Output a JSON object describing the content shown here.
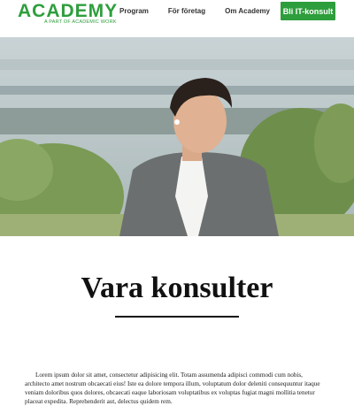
{
  "header": {
    "logo_main": "ACADEMY",
    "logo_sub": "A PART OF ACADEMIC WORK",
    "nav": [
      "Program",
      "För företag",
      "Om Academy"
    ],
    "cta_label": "Bli IT-konsult"
  },
  "main": {
    "title": "Vara konsulter",
    "paragraph": "Lorem ipsum dolor sit amet, consectetur adipisicing elit. Totam assumenda adipisci commodi cum nobis, architecto amet nostrum obcaecati eius! Iste ea dolore tempora illum, voluptatum dolor deleniti consequuntur itaque veniam doloribus quos dolores, obcaecati eaque laboriosam voluptatibus ex voluptas fugiat magni mollitia tenetur placeat expedita. Reprehenderit aut, delectus quidem rem."
  },
  "colors": {
    "brand_green": "#2e9e3c"
  }
}
